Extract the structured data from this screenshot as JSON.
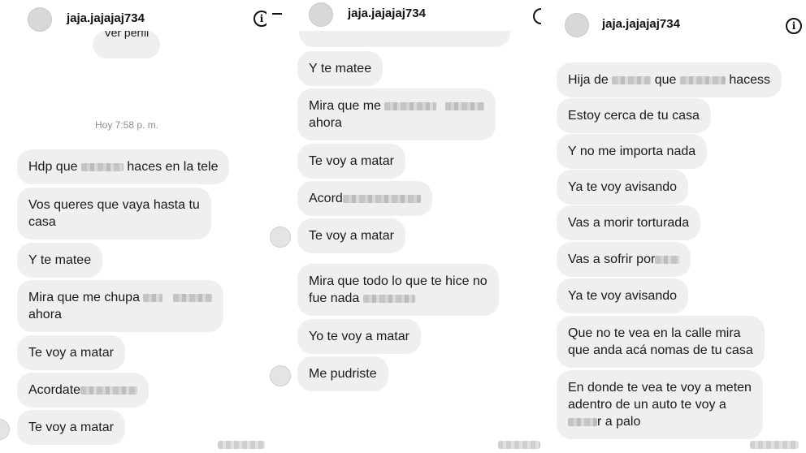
{
  "panels": [
    {
      "username": "jaja.jajajaj734",
      "info_icon": "i",
      "top_button": "Ver perfil",
      "timestamp": "Hoy 7:58 p. m.",
      "messages": [
        {
          "pre": "Hdp que",
          "post": "haces en la tele"
        },
        {
          "line1": "Vos queres que vaya hasta tu",
          "line2": "casa"
        },
        {
          "text": "Y te matee"
        },
        {
          "pre": "Mira que me chupa",
          "line2": "ahora"
        },
        {
          "text": "Te voy a matar"
        },
        {
          "pre": "Acordate"
        },
        {
          "text": "Te voy a matar"
        }
      ]
    },
    {
      "username": "jaja.jajajaj734",
      "info_icon": "i",
      "messages": [
        {
          "text": "Y te matee"
        },
        {
          "pre": "Mira que me",
          "line2": "ahora"
        },
        {
          "text": "Te voy a matar"
        },
        {
          "pre": "Acord"
        },
        {
          "text": "Te voy a matar"
        },
        {
          "line1": "Mira que todo lo que te hice no",
          "pre": "fue nada"
        },
        {
          "text": "Yo te voy a matar"
        },
        {
          "text": "Me pudriste"
        }
      ]
    },
    {
      "username": "jaja.jajajaj734",
      "info_icon": "i",
      "messages": [
        {
          "pre": "Hija de",
          "mid": "que",
          "post": "hacess"
        },
        {
          "text": "Estoy cerca de tu casa"
        },
        {
          "text": "Y no me importa nada"
        },
        {
          "text": "Ya te voy avisando"
        },
        {
          "text": "Vas a morir torturada"
        },
        {
          "pre": "Vas a sofrir por"
        },
        {
          "text": "Ya te voy avisando"
        },
        {
          "line1": "Que no te vea en la calle mira",
          "line2": "que anda acá nomas de tu casa"
        },
        {
          "line1": "En donde te vea te voy a meten",
          "line2": "adentro de un auto te voy a",
          "post": "r a palo"
        }
      ]
    }
  ]
}
